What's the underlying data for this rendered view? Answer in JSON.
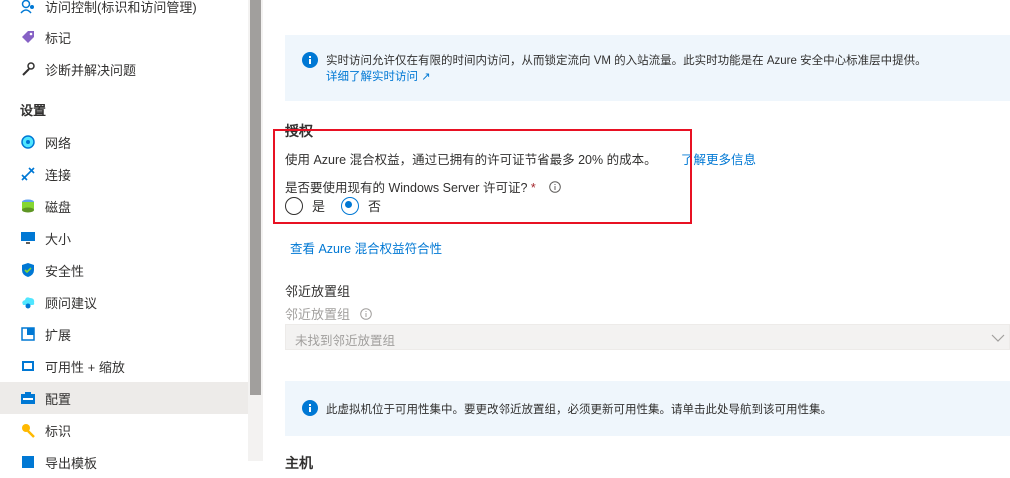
{
  "sidebar": {
    "items_top": [
      {
        "label": "访问控制(标识和访问管理)",
        "icon": "access-control-icon"
      },
      {
        "label": "标记",
        "icon": "tag-icon"
      },
      {
        "label": "诊断并解决问题",
        "icon": "wrench-icon"
      }
    ],
    "section_title": "设置",
    "items": [
      {
        "label": "网络",
        "icon": "network-icon"
      },
      {
        "label": "连接",
        "icon": "connect-icon"
      },
      {
        "label": "磁盘",
        "icon": "disk-icon"
      },
      {
        "label": "大小",
        "icon": "size-icon"
      },
      {
        "label": "安全性",
        "icon": "shield-icon"
      },
      {
        "label": "顾问建议",
        "icon": "advisor-icon"
      },
      {
        "label": "扩展",
        "icon": "extensions-icon"
      },
      {
        "label": "可用性 + 缩放",
        "icon": "availability-icon"
      },
      {
        "label": "配置",
        "icon": "configuration-icon",
        "selected": true
      },
      {
        "label": "标识",
        "icon": "identity-icon"
      },
      {
        "label": "导出模板",
        "icon": "export-template-icon"
      }
    ]
  },
  "jit_info": {
    "text": "实时访问允许仅在有限的时间内访问，从而锁定流向 VM 的入站流量。此实时功能是在 Azure 安全中心标准层中提供。",
    "link": "详细了解实时访问"
  },
  "license": {
    "heading": "授权",
    "description": "使用 Azure 混合权益，通过已拥有的许可证节省最多 20% 的成本。",
    "learn_more": "了解更多信息",
    "question": "是否要使用现有的 Windows Server 许可证?",
    "required_mark": "*",
    "option_yes": "是",
    "option_no": "否",
    "selected": "否",
    "compliance_link": "查看 Azure 混合权益符合性"
  },
  "ppg": {
    "heading": "邻近放置组",
    "label": "邻近放置组",
    "select_value": "未找到邻近放置组"
  },
  "availability_info": {
    "text": "此虚拟机位于可用性集中。要更改邻近放置组，必须更新可用性集。请单击此处导航到该可用性集。"
  },
  "next_heading": "主机",
  "colors": {
    "accent": "#0078d4",
    "highlight": "#e81123",
    "info_bg": "#eff6fc",
    "selected_bg": "#edebe9"
  }
}
